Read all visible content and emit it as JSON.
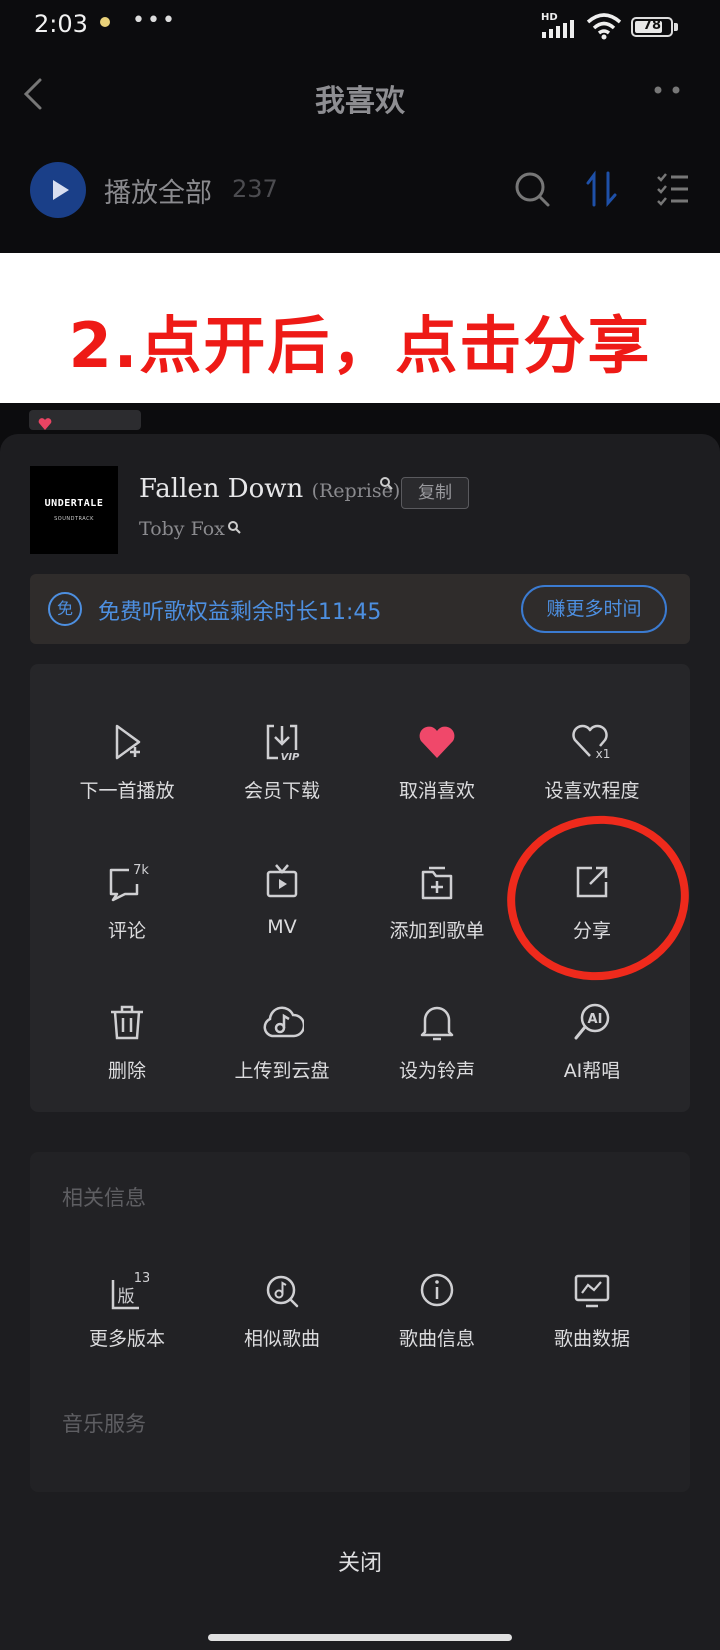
{
  "status_bar": {
    "time": "2:03",
    "dots": "•••",
    "network": "HD",
    "battery": "78",
    "battery_level": 0.78
  },
  "nav": {
    "title": "我喜欢"
  },
  "play_row": {
    "label": "播放全部",
    "count": "237"
  },
  "banner": {
    "text": "2.点开后，点击分享"
  },
  "song": {
    "album_title": "UNDERTALE",
    "album_subtitle": "SOUNDTRACK",
    "title": "Fallen Down",
    "subtitle": "(Reprise)",
    "artist": "Toby Fox",
    "copy_label": "复制"
  },
  "free_bar": {
    "icon_label": "免",
    "text": "免费听歌权益剩余时长11:45",
    "button_label": "赚更多时间"
  },
  "actions": [
    {
      "label": "下一首播放",
      "icon": "play-next-icon"
    },
    {
      "label": "会员下载",
      "icon": "vip-download-icon",
      "badge": "VIP"
    },
    {
      "label": "取消喜欢",
      "icon": "heart-filled-icon"
    },
    {
      "label": "设喜欢程度",
      "icon": "heart-level-icon",
      "badge": "x1"
    },
    {
      "label": "评论",
      "icon": "comment-icon",
      "badge": "7k"
    },
    {
      "label": "MV",
      "icon": "mv-icon"
    },
    {
      "label": "添加到歌单",
      "icon": "add-to-playlist-icon"
    },
    {
      "label": "分享",
      "icon": "share-icon"
    },
    {
      "label": "删除",
      "icon": "trash-icon"
    },
    {
      "label": "上传到云盘",
      "icon": "cloud-upload-icon"
    },
    {
      "label": "设为铃声",
      "icon": "bell-icon"
    },
    {
      "label": "AI帮唱",
      "icon": "ai-sing-icon",
      "badge": "AI"
    }
  ],
  "related_info": {
    "title": "相关信息",
    "items": [
      {
        "label": "更多版本",
        "icon": "versions-icon",
        "glyph": "版",
        "badge": "13"
      },
      {
        "label": "相似歌曲",
        "icon": "similar-songs-icon"
      },
      {
        "label": "歌曲信息",
        "icon": "info-icon"
      },
      {
        "label": "歌曲数据",
        "icon": "song-data-icon"
      }
    ]
  },
  "music_service": {
    "title": "音乐服务"
  },
  "close_label": "关闭",
  "colors": {
    "accent_blue": "#4d8fe0",
    "heart_red": "#f0486a",
    "annotation_red": "#ee1a16",
    "sheet_bg": "#1d1d20"
  }
}
